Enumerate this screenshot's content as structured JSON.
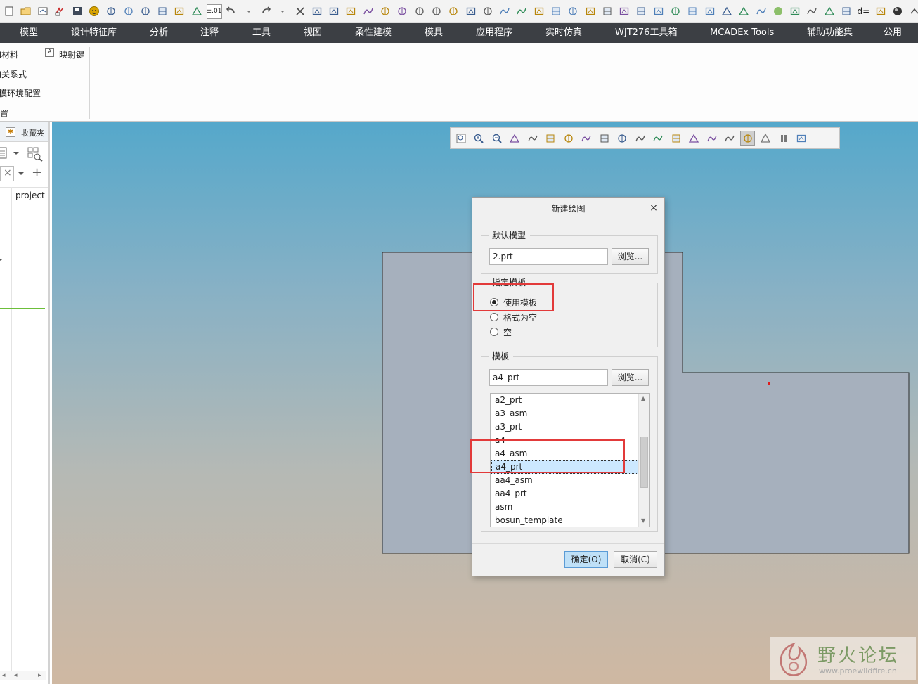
{
  "quick_access": {
    "icons": [
      "new-icon",
      "open-icon",
      "open-recent-icon",
      "regenerate-icon",
      "save-icon",
      "smiley-icon",
      "window-icon",
      "window-close-icon",
      "copy-window-icon",
      "tree-icon",
      "model-display-icon",
      "print-icon"
    ],
    "tolerance_label": "±.01",
    "icons_after": [
      "undo-icon",
      "undo-dropdown-icon",
      "redo-icon",
      "redo-dropdown-icon",
      "close-window-icon",
      "sketch-icon",
      "edit-icon",
      "plane-icon",
      "axis-icon",
      "point-icon",
      "curve-icon",
      "csys-icon",
      "hatch-icon",
      "measure-icon",
      "analysis-icon",
      "line-icon",
      "copy-icon",
      "paste-icon",
      "merge-icon",
      "mirror-icon",
      "surface-icon",
      "table-icon",
      "feature-icon",
      "image-icon",
      "flag-icon",
      "section-icon",
      "layer-icon",
      "box-icon",
      "spline-icon",
      "cross-icon",
      "parallelogram-icon",
      "pen-icon",
      "sphere-icon",
      "lock-icon",
      "hide-icon",
      "show-icon",
      "appearance-icon"
    ],
    "dim_label": "d=",
    "icons_end": [
      "switch-icon",
      "shade-icon",
      "chevron-icon"
    ]
  },
  "tabs": [
    "模型",
    "设计特征库",
    "分析",
    "注释",
    "工具",
    "视图",
    "柔性建模",
    "模具",
    "应用程序",
    "实时仿真",
    "WJT276工具箱",
    "MCADEx Tools",
    "辅助功能集",
    "公用"
  ],
  "ribbon": {
    "items": [
      "加材料",
      "加关系式",
      "建模环境配置",
      "设置"
    ],
    "mapkey_label": "映射键",
    "mapkey_icon_text": "A"
  },
  "navigator": {
    "favorites_label": "收藏夹",
    "column_header": "project",
    "close_symbol": "×",
    "add_symbol": "+"
  },
  "view_toolbar": {
    "icons": [
      "refit-icon",
      "zoom-in-icon",
      "zoom-out-icon",
      "repaint-icon",
      "shading-icon",
      "perspective-icon",
      "saved-views-icon",
      "view-manager-icon",
      "display-style-icon",
      "annotations-icon",
      "datum-display-icon",
      "plane-display-icon",
      "axis-display-icon",
      "point-display-icon",
      "csys-display-icon",
      "spin-center-icon",
      "select-mode-icon",
      "triangle-icon",
      "pause-icon",
      "dock-icon"
    ]
  },
  "dialog": {
    "title": "新建绘图",
    "close_symbol": "×",
    "default_model_label": "默认模型",
    "default_model_value": "2.prt",
    "browse_label": "浏览...",
    "template_spec_label": "指定模板",
    "radio_options": [
      {
        "label": "使用模板",
        "checked": true
      },
      {
        "label": "格式为空",
        "checked": false
      },
      {
        "label": "空",
        "checked": false
      }
    ],
    "template_label": "模板",
    "template_value": "a4_prt",
    "templates": [
      "a2_prt",
      "a3_asm",
      "a3_prt",
      "a4",
      "a4_asm",
      "a4_prt",
      "aa4_asm",
      "aa4_prt",
      "asm",
      "bosun_template"
    ],
    "selected_template": "a4_prt",
    "ok_label": "确定(O)",
    "cancel_label": "取消(C)"
  },
  "watermark": {
    "title": "野火论坛",
    "url": "www.proewildfire.cn"
  },
  "colors": {
    "tab_bar": "#3c3f44",
    "highlight": "#e23a3a",
    "selection": "#cce8ff",
    "model_face": "#a6b0bd",
    "ok_button": "#bfe0f7"
  }
}
